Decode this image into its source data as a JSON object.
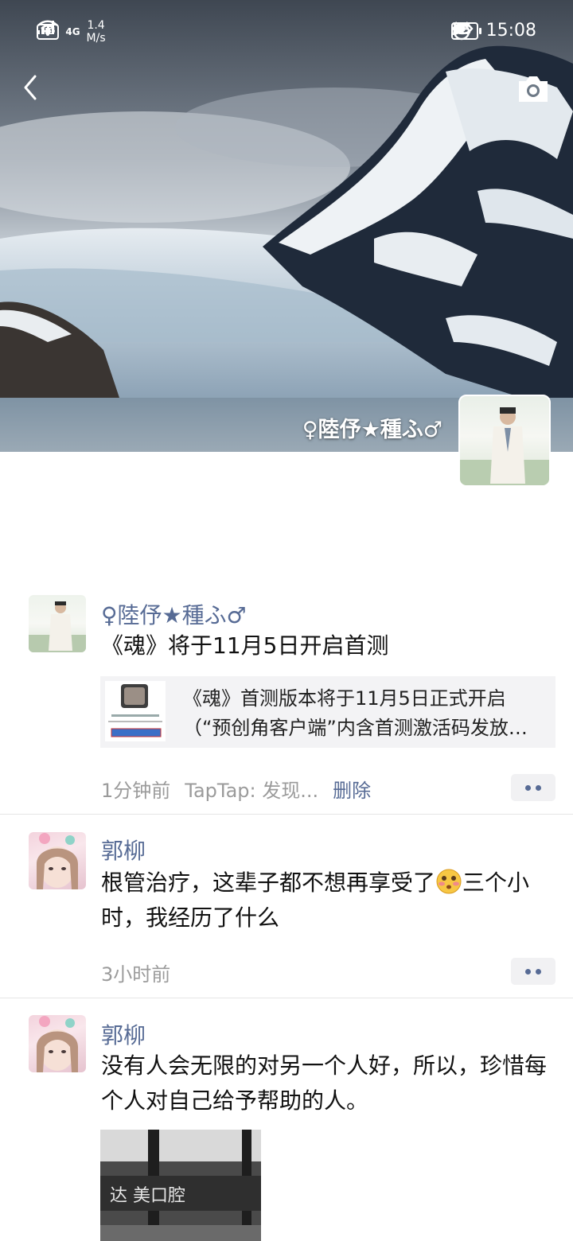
{
  "status_bar": {
    "hd": "HD",
    "network": "4G",
    "speed_value": "1.4",
    "speed_unit": "M/s",
    "battery": "95",
    "time": "15:08"
  },
  "profile": {
    "name": "♀陸伃★種ふ♂"
  },
  "posts": [
    {
      "nickname": "♀陸伃★種ふ♂",
      "text": "《魂》将于11月5日开启首测",
      "share": {
        "line1": "《魂》首测版本将于11月5日正式开启",
        "line2": "（“预创角客户端”内含首测激活码发放…"
      },
      "time": "1分钟前",
      "source": "TapTap: 发现...",
      "delete_label": "删除"
    },
    {
      "nickname": "郭柳",
      "text_part1": "根管治疗，这辈子都不想再享受了",
      "text_part2": "三个小时，我经历了什么",
      "time": "3小时前"
    },
    {
      "nickname": "郭柳",
      "text": "没有人会无限的对另一个人好，所以，珍惜每个人对自己给予帮助的人。"
    }
  ]
}
